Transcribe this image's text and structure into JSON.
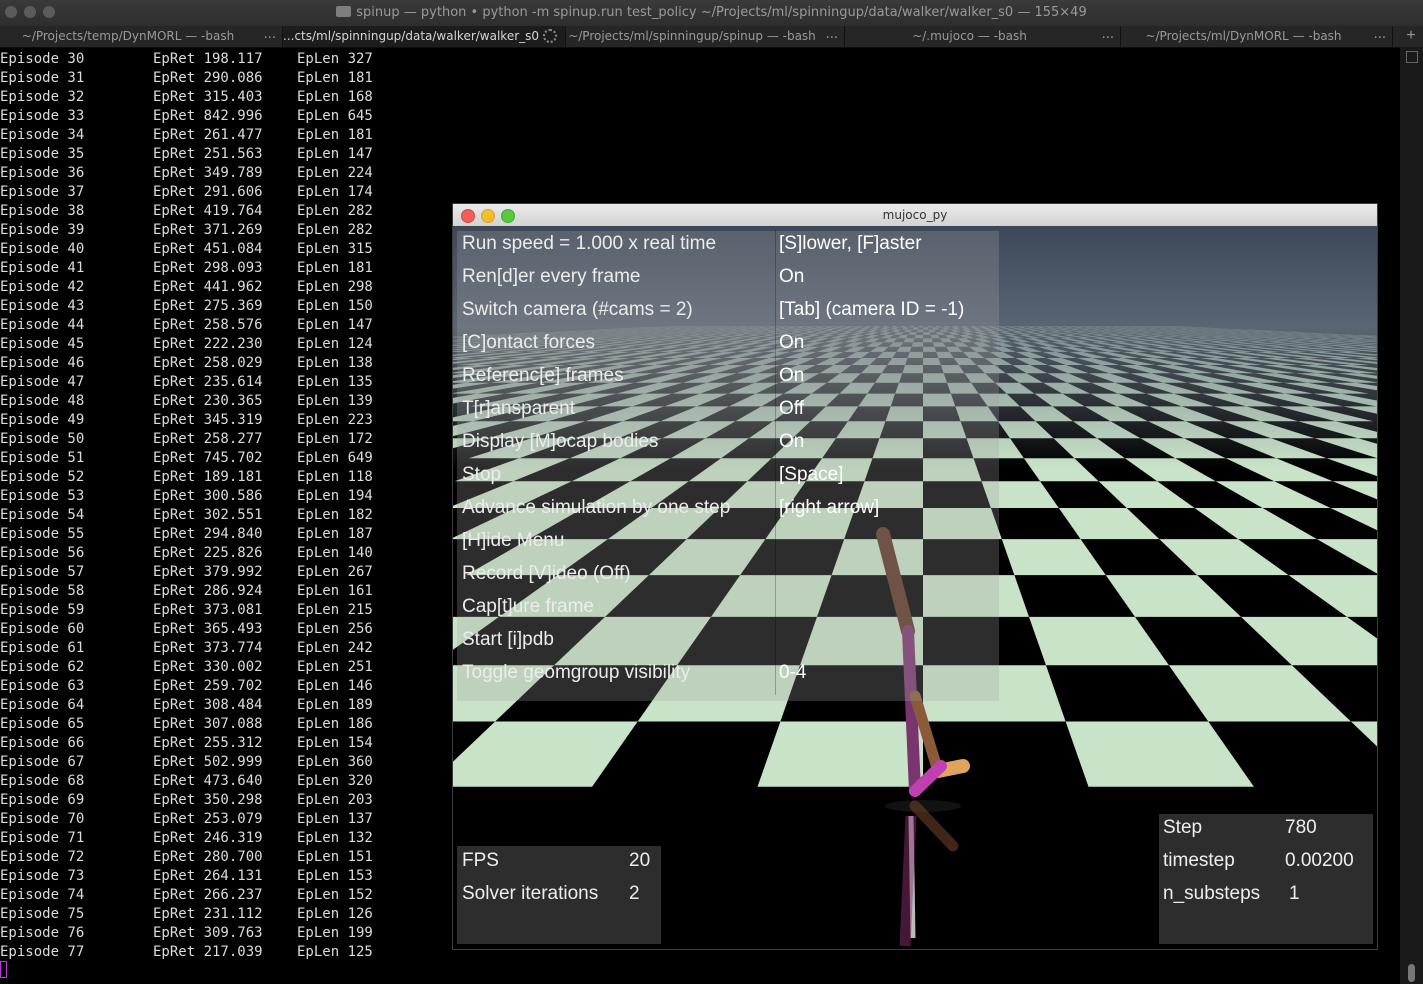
{
  "window": {
    "title": "spinup — python • python -m spinup.run test_policy ~/Projects/ml/spinningup/data/walker/walker_s0 — 155×49"
  },
  "tabs": [
    {
      "label": "~/Projects/temp/DynMORL — -bash"
    },
    {
      "label": "...cts/ml/spinningup/data/walker/walker_s0"
    },
    {
      "label": "~/Projects/ml/spinningup/spinup — -bash"
    },
    {
      "label": "~/.mujoco — -bash"
    },
    {
      "label": "~/Projects/ml/DynMORL — -bash"
    }
  ],
  "tab_ellipsis": "...",
  "new_tab": "+",
  "episodes": [
    {
      "ep": "Episode 30",
      "ret": "EpRet 198.117",
      "len": "EpLen 327"
    },
    {
      "ep": "Episode 31",
      "ret": "EpRet 290.086",
      "len": "EpLen 181"
    },
    {
      "ep": "Episode 32",
      "ret": "EpRet 315.403",
      "len": "EpLen 168"
    },
    {
      "ep": "Episode 33",
      "ret": "EpRet 842.996",
      "len": "EpLen 645"
    },
    {
      "ep": "Episode 34",
      "ret": "EpRet 261.477",
      "len": "EpLen 181"
    },
    {
      "ep": "Episode 35",
      "ret": "EpRet 251.563",
      "len": "EpLen 147"
    },
    {
      "ep": "Episode 36",
      "ret": "EpRet 349.789",
      "len": "EpLen 224"
    },
    {
      "ep": "Episode 37",
      "ret": "EpRet 291.606",
      "len": "EpLen 174"
    },
    {
      "ep": "Episode 38",
      "ret": "EpRet 419.764",
      "len": "EpLen 282"
    },
    {
      "ep": "Episode 39",
      "ret": "EpRet 371.269",
      "len": "EpLen 282"
    },
    {
      "ep": "Episode 40",
      "ret": "EpRet 451.084",
      "len": "EpLen 315"
    },
    {
      "ep": "Episode 41",
      "ret": "EpRet 298.093",
      "len": "EpLen 181"
    },
    {
      "ep": "Episode 42",
      "ret": "EpRet 441.962",
      "len": "EpLen 298"
    },
    {
      "ep": "Episode 43",
      "ret": "EpRet 275.369",
      "len": "EpLen 150"
    },
    {
      "ep": "Episode 44",
      "ret": "EpRet 258.576",
      "len": "EpLen 147"
    },
    {
      "ep": "Episode 45",
      "ret": "EpRet 222.230",
      "len": "EpLen 124"
    },
    {
      "ep": "Episode 46",
      "ret": "EpRet 258.029",
      "len": "EpLen 138"
    },
    {
      "ep": "Episode 47",
      "ret": "EpRet 235.614",
      "len": "EpLen 135"
    },
    {
      "ep": "Episode 48",
      "ret": "EpRet 230.365",
      "len": "EpLen 139"
    },
    {
      "ep": "Episode 49",
      "ret": "EpRet 345.319",
      "len": "EpLen 223"
    },
    {
      "ep": "Episode 50",
      "ret": "EpRet 258.277",
      "len": "EpLen 172"
    },
    {
      "ep": "Episode 51",
      "ret": "EpRet 745.702",
      "len": "EpLen 649"
    },
    {
      "ep": "Episode 52",
      "ret": "EpRet 189.181",
      "len": "EpLen 118"
    },
    {
      "ep": "Episode 53",
      "ret": "EpRet 300.586",
      "len": "EpLen 194"
    },
    {
      "ep": "Episode 54",
      "ret": "EpRet 302.551",
      "len": "EpLen 182"
    },
    {
      "ep": "Episode 55",
      "ret": "EpRet 294.840",
      "len": "EpLen 187"
    },
    {
      "ep": "Episode 56",
      "ret": "EpRet 225.826",
      "len": "EpLen 140"
    },
    {
      "ep": "Episode 57",
      "ret": "EpRet 379.992",
      "len": "EpLen 267"
    },
    {
      "ep": "Episode 58",
      "ret": "EpRet 286.924",
      "len": "EpLen 161"
    },
    {
      "ep": "Episode 59",
      "ret": "EpRet 373.081",
      "len": "EpLen 215"
    },
    {
      "ep": "Episode 60",
      "ret": "EpRet 365.493",
      "len": "EpLen 256"
    },
    {
      "ep": "Episode 61",
      "ret": "EpRet 373.774",
      "len": "EpLen 242"
    },
    {
      "ep": "Episode 62",
      "ret": "EpRet 330.002",
      "len": "EpLen 251"
    },
    {
      "ep": "Episode 63",
      "ret": "EpRet 259.702",
      "len": "EpLen 146"
    },
    {
      "ep": "Episode 64",
      "ret": "EpRet 308.484",
      "len": "EpLen 189"
    },
    {
      "ep": "Episode 65",
      "ret": "EpRet 307.088",
      "len": "EpLen 186"
    },
    {
      "ep": "Episode 66",
      "ret": "EpRet 255.312",
      "len": "EpLen 154"
    },
    {
      "ep": "Episode 67",
      "ret": "EpRet 502.999",
      "len": "EpLen 360"
    },
    {
      "ep": "Episode 68",
      "ret": "EpRet 473.640",
      "len": "EpLen 320"
    },
    {
      "ep": "Episode 69",
      "ret": "EpRet 350.298",
      "len": "EpLen 203"
    },
    {
      "ep": "Episode 70",
      "ret": "EpRet 253.079",
      "len": "EpLen 137"
    },
    {
      "ep": "Episode 71",
      "ret": "EpRet 246.319",
      "len": "EpLen 132"
    },
    {
      "ep": "Episode 72",
      "ret": "EpRet 280.700",
      "len": "EpLen 151"
    },
    {
      "ep": "Episode 73",
      "ret": "EpRet 264.131",
      "len": "EpLen 153"
    },
    {
      "ep": "Episode 74",
      "ret": "EpRet 266.237",
      "len": "EpLen 152"
    },
    {
      "ep": "Episode 75",
      "ret": "EpRet 231.112",
      "len": "EpLen 126"
    },
    {
      "ep": "Episode 76",
      "ret": "EpRet 309.763",
      "len": "EpLen 199"
    },
    {
      "ep": "Episode 77",
      "ret": "EpRet 217.039",
      "len": "EpLen 125"
    }
  ],
  "mujoco": {
    "title": "mujoco_py",
    "menu": [
      {
        "label": "Run speed = 1.000 x real time",
        "value": "[S]lower, [F]aster"
      },
      {
        "label": "Ren[d]er every frame",
        "value": "On"
      },
      {
        "label": "Switch camera (#cams = 2)",
        "value": "[Tab] (camera ID = -1)"
      },
      {
        "label": "[C]ontact forces",
        "value": "On"
      },
      {
        "label": "Referenc[e] frames",
        "value": "On"
      },
      {
        "label": "T[r]ansparent",
        "value": "Off"
      },
      {
        "label": "Display [M]ocap bodies",
        "value": "On"
      },
      {
        "label": "Stop",
        "value": "[Space]"
      },
      {
        "label": "Advance simulation by one step",
        "value": "[right arrow]"
      },
      {
        "label": "[H]ide Menu",
        "value": ""
      },
      {
        "label": "Record [V]ideo (Off)",
        "value": ""
      },
      {
        "label": "Cap[t]ure frame",
        "value": ""
      },
      {
        "label": "Start [i]pdb",
        "value": ""
      },
      {
        "label": "Toggle geomgroup visibility",
        "value": "0-4"
      }
    ],
    "fps_label": "FPS",
    "fps": "20",
    "solver_label": "Solver iterations",
    "solver": "2",
    "step_label": "Step",
    "step": "780",
    "timestep_label": "timestep",
    "timestep": "0.00200",
    "substeps_label": "n_substeps",
    "substeps": "1"
  },
  "colors": {
    "floor_light": "#c9e3c8",
    "floor_dark": "#000000",
    "sky": "#3d4a5a",
    "walker_brown": "#5a3523",
    "walker_magenta": "#b83fa8",
    "walker_orange": "#e0a45c"
  }
}
